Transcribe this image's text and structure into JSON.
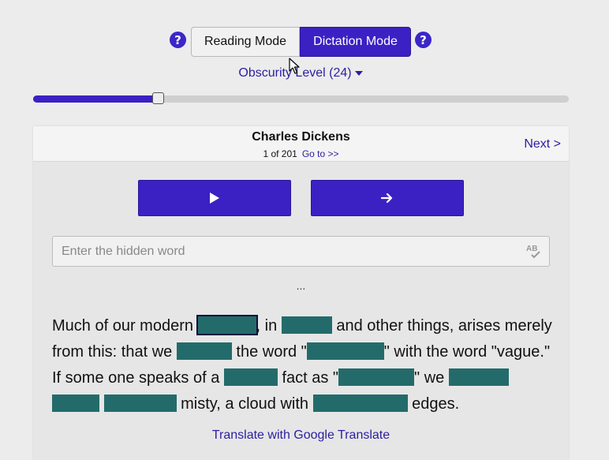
{
  "modes": {
    "reading_label": "Reading Mode",
    "dictation_label": "Dictation Mode",
    "help_glyph": "?"
  },
  "obscurity": {
    "label": "Obscurity Level (24)",
    "level_fraction": 0.233
  },
  "card": {
    "author": "Charles Dickens",
    "counter": "1 of 201",
    "goto_label": "Go to >>",
    "next_label": "Next >",
    "input_placeholder": "Enter the hidden word",
    "ellipsis": "..."
  },
  "passage": {
    "t0": "Much of our modern ",
    "t1": ", in ",
    "t2": " and other things, arises merely from this: that we ",
    "t3": " the word \"",
    "t4": "\" with the word \"vague.\" If some one speaks of a ",
    "t5": " fact as \"",
    "t6": "\" we ",
    "t7": " misty, a cloud with ",
    "t8": " edges."
  },
  "translate_label": "Translate with Google Translate",
  "colors": {
    "accent": "#3b21c4",
    "hidden_word": "#236b6b",
    "link": "#2c1ea0"
  },
  "icons": {
    "play": "play-icon",
    "next": "arrow-right-icon",
    "spell": "spellcheck-icon",
    "help": "help-icon"
  }
}
